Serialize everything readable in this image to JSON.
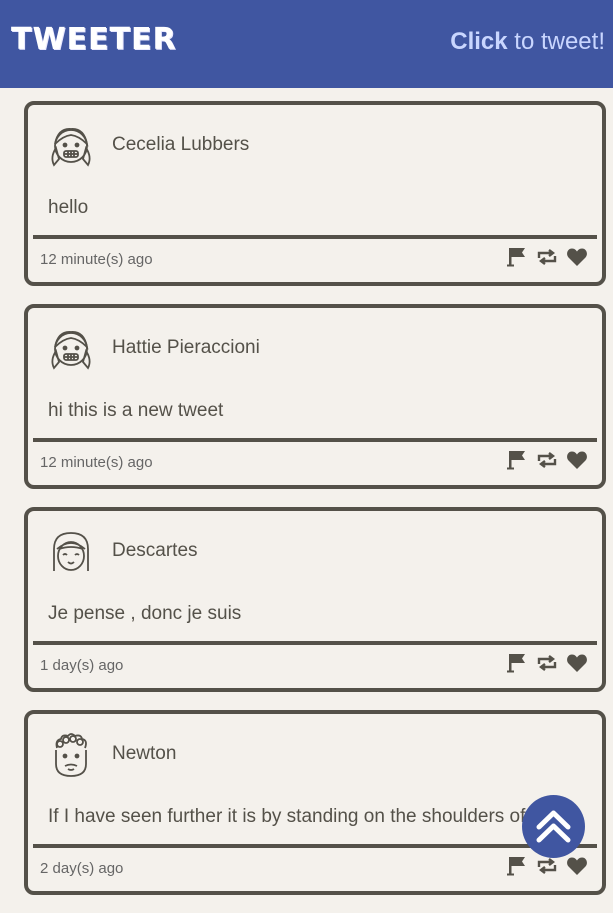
{
  "nav": {
    "logo": "TWEETER",
    "compose_strong": "Click",
    "compose_rest": " to tweet!"
  },
  "tweets": [
    {
      "name": "Cecelia Lubbers",
      "content": "hello",
      "time": "12 minute(s) ago",
      "avatar_icon": "girl-braces-avatar-icon"
    },
    {
      "name": "Hattie Pieraccioni",
      "content": "hi this is a new tweet",
      "time": "12 minute(s) ago",
      "avatar_icon": "girl-braces-avatar-icon"
    },
    {
      "name": "Descartes",
      "content": "Je pense , donc je suis",
      "time": "1 day(s) ago",
      "avatar_icon": "girl-bangs-avatar-icon"
    },
    {
      "name": "Newton",
      "content": "If I have seen further it is by standing on the shoulders of giants",
      "time": "2 day(s) ago",
      "avatar_icon": "curly-hair-avatar-icon"
    }
  ],
  "actions": [
    "flag-icon",
    "retweet-icon",
    "heart-icon"
  ],
  "colors": {
    "nav": "#4056a1",
    "compose": "#c9d6ff",
    "border": "#545149",
    "background": "#f4f1ec"
  }
}
